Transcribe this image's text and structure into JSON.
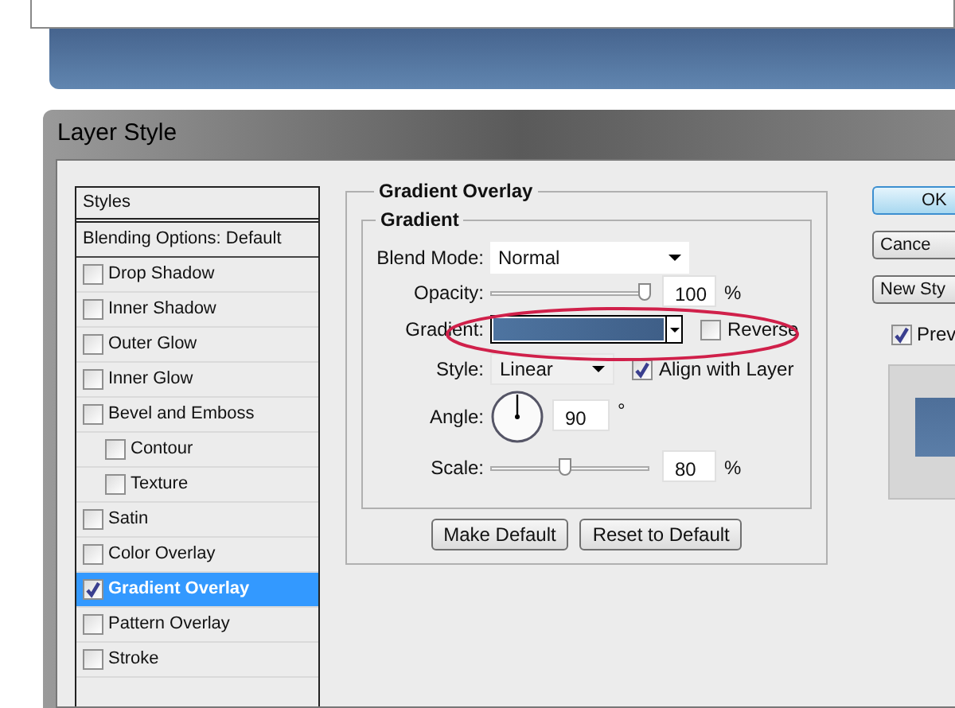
{
  "window": {
    "title": "Layer Style"
  },
  "styles_list": {
    "header": "Styles",
    "blending": "Blending Options: Default",
    "items": [
      {
        "label": "Drop Shadow",
        "checked": false,
        "selected": false
      },
      {
        "label": "Inner Shadow",
        "checked": false,
        "selected": false
      },
      {
        "label": "Outer Glow",
        "checked": false,
        "selected": false
      },
      {
        "label": "Inner Glow",
        "checked": false,
        "selected": false
      },
      {
        "label": "Bevel and Emboss",
        "checked": false,
        "selected": false,
        "children": [
          {
            "label": "Contour",
            "checked": false,
            "selected": false
          },
          {
            "label": "Texture",
            "checked": false,
            "selected": false
          }
        ]
      },
      {
        "label": "Satin",
        "checked": false,
        "selected": false
      },
      {
        "label": "Color Overlay",
        "checked": false,
        "selected": false
      },
      {
        "label": "Gradient Overlay",
        "checked": true,
        "selected": true
      },
      {
        "label": "Pattern Overlay",
        "checked": false,
        "selected": false
      },
      {
        "label": "Stroke",
        "checked": false,
        "selected": false
      }
    ]
  },
  "gradient_overlay": {
    "title": "Gradient Overlay",
    "group_title": "Gradient",
    "blend_mode": {
      "label": "Blend Mode:",
      "value": "Normal"
    },
    "opacity": {
      "label": "Opacity:",
      "level": 0.97,
      "value": "100",
      "unit": "%"
    },
    "gradient": {
      "label": "Gradient:"
    },
    "reverse": {
      "label": "Reverse",
      "checked": false
    },
    "style": {
      "label": "Style:",
      "value": "Linear"
    },
    "align": {
      "label": "Align with Layer",
      "checked": true
    },
    "angle": {
      "label": "Angle:",
      "value": "90",
      "unit": "°"
    },
    "scale": {
      "label": "Scale:",
      "level": 0.47,
      "value": "80",
      "unit": "%"
    },
    "buttons": [
      "Make Default",
      "Reset to Default"
    ]
  },
  "side_buttons": [
    {
      "label": "OK",
      "focused": true
    },
    {
      "label": "Cance",
      "focused": false
    },
    {
      "label": "New Sty",
      "focused": false
    }
  ],
  "preview": {
    "label": "Prev",
    "checked": true
  }
}
